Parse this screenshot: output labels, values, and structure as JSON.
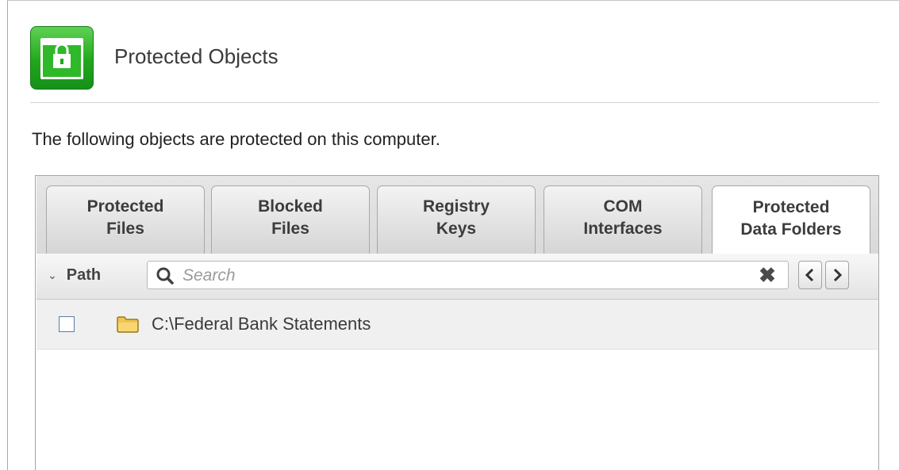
{
  "header": {
    "title": "Protected Objects",
    "icon": "lock-window-icon",
    "icon_color": "#22a71c"
  },
  "intro": {
    "text": "The following objects are protected on this computer."
  },
  "tabs": [
    {
      "label": "Protected\nFiles",
      "active": false
    },
    {
      "label": "Blocked\nFiles",
      "active": false
    },
    {
      "label": "Registry\nKeys",
      "active": false
    },
    {
      "label": "COM\nInterfaces",
      "active": false
    },
    {
      "label": "Protected\nData Folders",
      "active": true
    }
  ],
  "toolbar": {
    "column_label": "Path",
    "search_placeholder": "Search",
    "search_value": "",
    "clear_icon": "close-icon",
    "prev_icon": "chevron-left-icon",
    "next_icon": "chevron-right-icon"
  },
  "rows": [
    {
      "path": "C:\\Federal Bank Statements",
      "checked": false,
      "icon": "folder-icon"
    }
  ]
}
